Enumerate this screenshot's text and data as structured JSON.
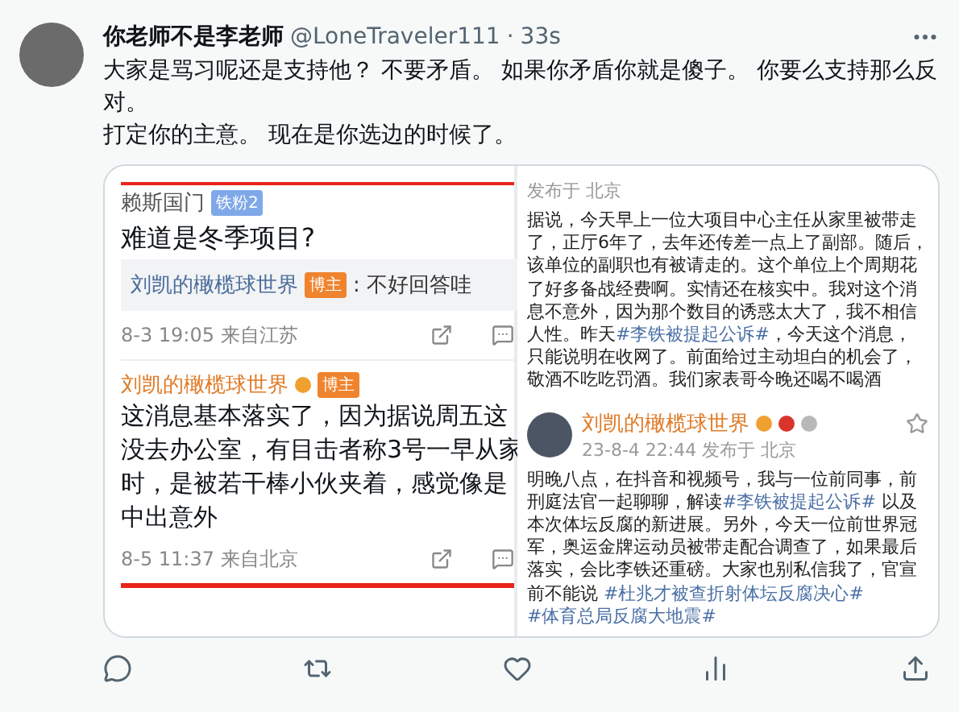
{
  "tweet": {
    "author_name": "你老师不是李老师",
    "handle": "@LoneTraveler111",
    "separator": "·",
    "time": "33s",
    "paragraphs": [
      "大家是骂习呢还是支持他？ 不要矛盾。 如果你矛盾你就是傻子。 你要么支持那么反对。",
      "打定你的主意。 现在是你选边的时候了。"
    ]
  },
  "media": {
    "left": {
      "comment": {
        "user": "赖斯国门",
        "badge": {
          "text": "铁粉2",
          "kind": "fan"
        },
        "text": "难道是冬季项目?",
        "reply_user": "刘凯的橄榄球世界",
        "reply_badge": {
          "text": "博主",
          "kind": "host"
        },
        "reply_text": ": 不好回答哇",
        "meta": "8-3 19:05 来自江苏"
      },
      "post": {
        "user": "刘凯的橄榄球世界",
        "badge": {
          "text": "博主",
          "kind": "host"
        },
        "lines": [
          "这消息基本落实了，因为据说周五这",
          "没去办公室，有目击者称3号一早从家",
          "时，是被若干棒小伙夹着，感觉像是",
          "中出意外"
        ],
        "meta": "8-5 11:37 来自北京"
      }
    },
    "right": {
      "post1": {
        "meta": "发布于 北京",
        "segments": [
          {
            "kind": "plain",
            "text": "据说，今天早上一位大项目中心主任从家里被带走了，正厅6年了，去年还传差一点上了副部。随后，该单位的副职也有被请走的。这个单位上个周期花了好多备战经费啊。实情还在核实中。我对这个消息不意外，因为那个数目的诱惑太大了，我不相信人性。昨天"
          },
          {
            "kind": "hashtag",
            "text": "#李铁被提起公诉#"
          },
          {
            "kind": "plain",
            "text": "，今天这个消息，只能说明在收网了。前面给过主动坦白的机会了，敬酒不吃吃罚酒。我们家表哥今晚还喝不喝酒"
          }
        ]
      },
      "post2": {
        "user": "刘凯的橄榄球世界",
        "meta": "23-8-4 22:44 发布于 北京",
        "segments": [
          {
            "kind": "plain",
            "text": "明晚八点，在抖音和视频号，我与一位前同事，前刑庭法官一起聊聊，解读"
          },
          {
            "kind": "hashtag",
            "text": "#李铁被提起公诉#"
          },
          {
            "kind": "plain",
            "text": " 以及本次体坛反腐的新进展。另外，今天一位前世界冠军，奥运金牌运动员被带走配合调查了，如果最后落实，会比李铁还重磅。大家也别私信我了，官宣前不能说 "
          },
          {
            "kind": "hashtag",
            "text": "#杜兆才被查折射体坛反腐决心#"
          },
          {
            "kind": "hashtag",
            "text": "#体育总局反腐大地震#"
          }
        ]
      }
    }
  },
  "actions": [
    {
      "kind": "reply"
    },
    {
      "kind": "retweet"
    },
    {
      "kind": "like"
    },
    {
      "kind": "views"
    },
    {
      "kind": "share"
    }
  ]
}
